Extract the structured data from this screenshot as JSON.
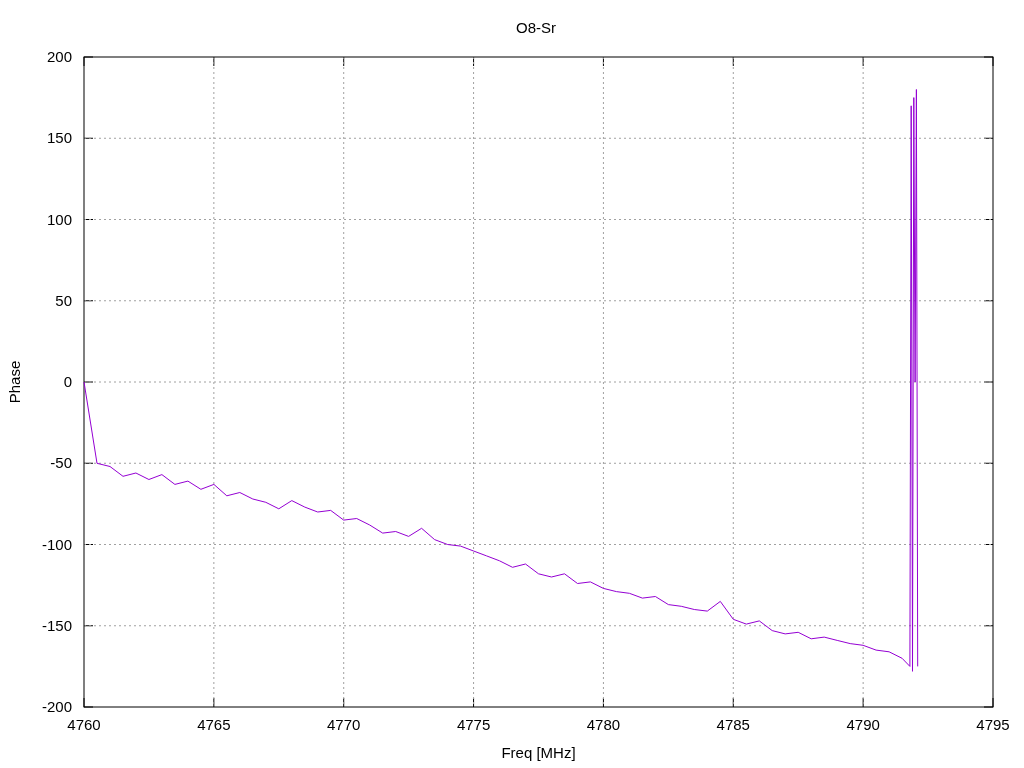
{
  "chart_data": {
    "type": "line",
    "title": "O8-Sr",
    "xlabel": "Freq [MHz]",
    "ylabel": "Phase",
    "x": [
      4760,
      4760.5,
      4761,
      4761.5,
      4762,
      4762.5,
      4763,
      4763.5,
      4764,
      4764.5,
      4765,
      4765.5,
      4766,
      4766.5,
      4767,
      4767.5,
      4768,
      4768.5,
      4769,
      4769.5,
      4770,
      4770.5,
      4771,
      4771.5,
      4772,
      4772.5,
      4773,
      4773.5,
      4774,
      4774.5,
      4775,
      4775.5,
      4776,
      4776.5,
      4777,
      4777.5,
      4778,
      4778.5,
      4779,
      4779.5,
      4780,
      4780.5,
      4781,
      4781.5,
      4782,
      4782.5,
      4783,
      4783.5,
      4784,
      4784.5,
      4785,
      4785.5,
      4786,
      4786.5,
      4787,
      4787.5,
      4788,
      4788.5,
      4789,
      4789.5,
      4790,
      4790.5,
      4791,
      4791.5,
      4791.8,
      4791.85,
      4791.9,
      4791.95,
      4792,
      4792.05,
      4792.1
    ],
    "series": [
      {
        "color": "#9400d3",
        "values": [
          0,
          -50,
          -52,
          -58,
          -56,
          -60,
          -57,
          -63,
          -61,
          -66,
          -63,
          -70,
          -68,
          -72,
          -74,
          -78,
          -73,
          -77,
          -80,
          -79,
          -85,
          -84,
          -88,
          -93,
          -92,
          -95,
          -90,
          -97,
          -100,
          -101,
          -104,
          -107,
          -110,
          -114,
          -112,
          -118,
          -120,
          -118,
          -124,
          -123,
          -127,
          -129,
          -130,
          -133,
          -132,
          -137,
          -138,
          -140,
          -141,
          -135,
          -146,
          -149,
          -147,
          -153,
          -155,
          -154,
          -158,
          -157,
          -159,
          -161,
          -162,
          -165,
          -166,
          -170,
          -175,
          170,
          -178,
          175,
          0,
          180,
          -175
        ]
      }
    ],
    "xlim": [
      4760,
      4795
    ],
    "ylim": [
      -200,
      200
    ],
    "xticks": [
      4760,
      4765,
      4770,
      4775,
      4780,
      4785,
      4790,
      4795
    ],
    "yticks": [
      -200,
      -150,
      -100,
      -50,
      0,
      50,
      100,
      150,
      200
    ],
    "grid": true
  }
}
